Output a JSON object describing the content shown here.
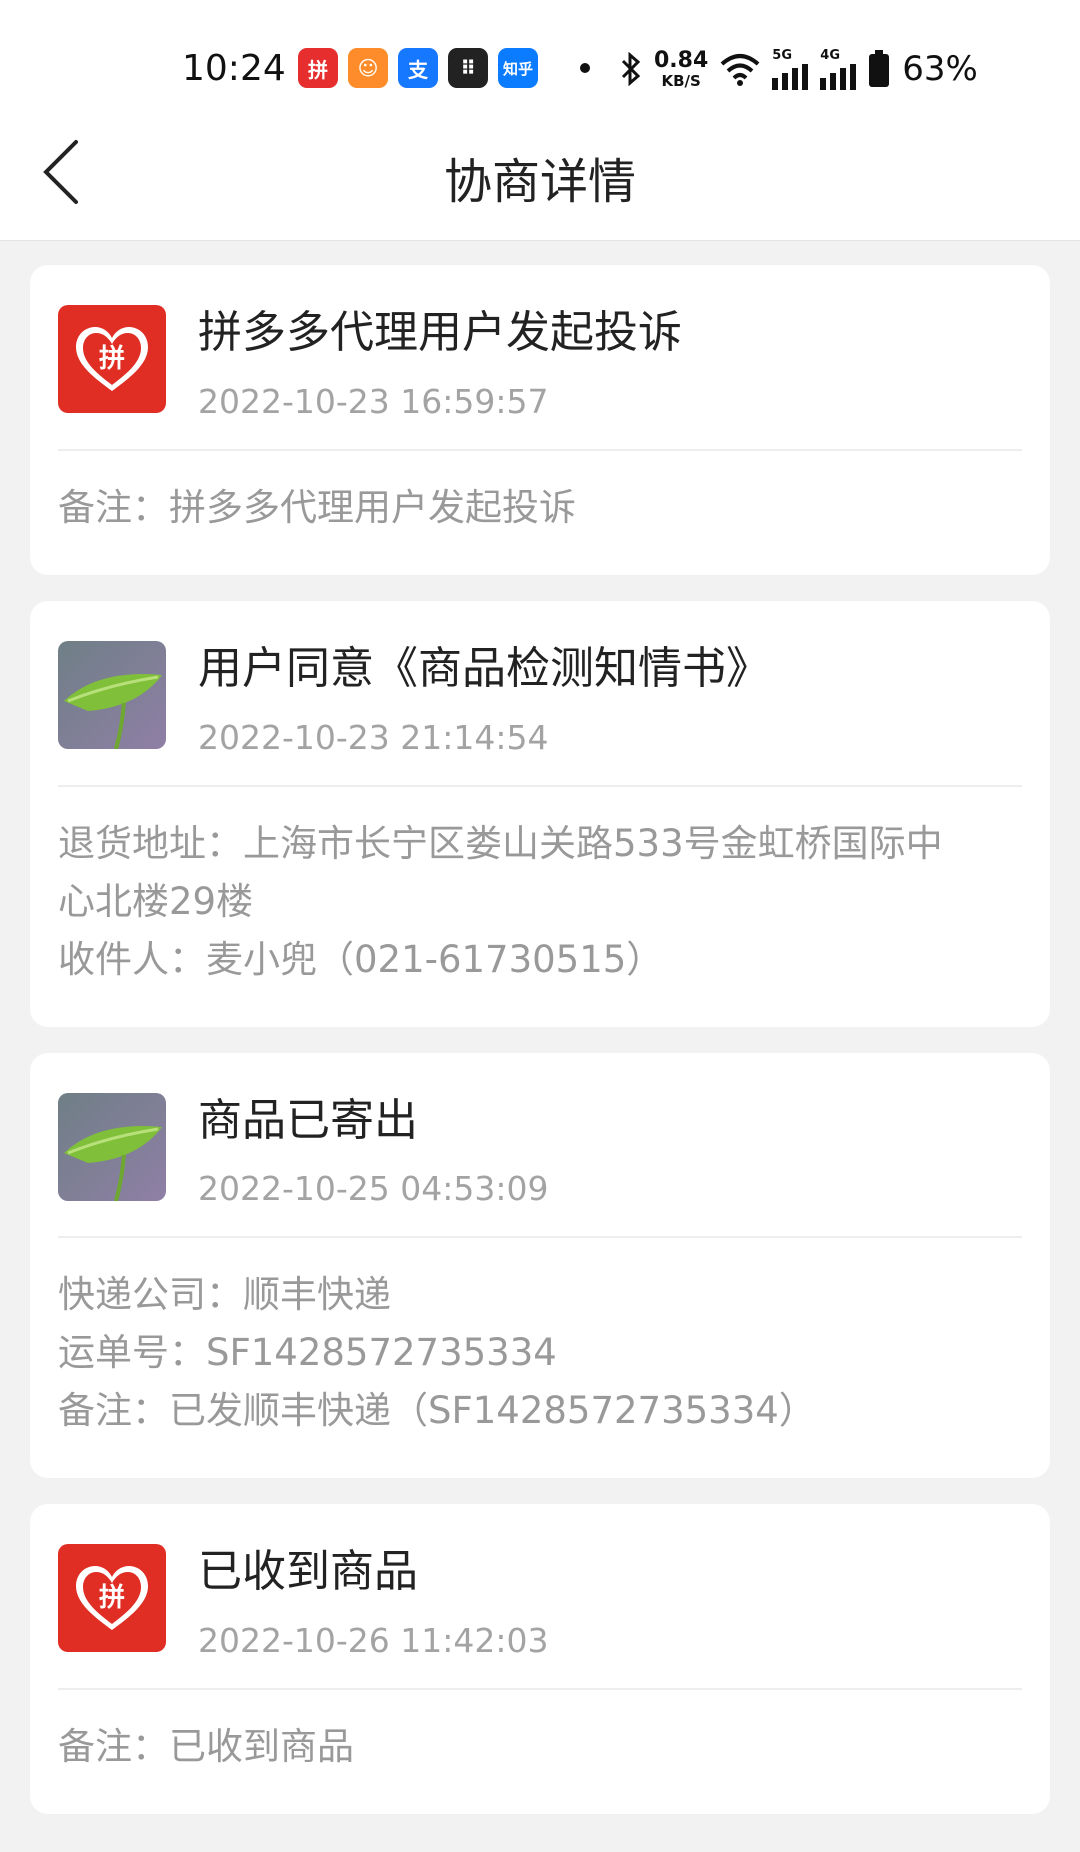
{
  "status_bar": {
    "time": "10:24",
    "apps": [
      {
        "icon": "pinduoduo-icon",
        "glyph": "拼"
      },
      {
        "icon": "person-app-icon",
        "glyph": "☺"
      },
      {
        "icon": "alipay-icon",
        "glyph": "支"
      },
      {
        "icon": "dots-app-icon",
        "glyph": "⠿"
      },
      {
        "icon": "zhihu-icon",
        "glyph": "知乎"
      }
    ],
    "net_speed_value": "0.84",
    "net_speed_unit": "KB/S",
    "signal_1": "5G",
    "signal_2": "4G",
    "battery": "63%"
  },
  "header": {
    "title": "协商详情"
  },
  "records": [
    {
      "avatar": "pinduoduo-logo",
      "title": "拼多多代理用户发起投诉",
      "time": "2022-10-23 16:59:57",
      "lines": [
        "备注：拼多多代理用户发起投诉"
      ]
    },
    {
      "avatar": "user-leaf-avatar",
      "title": "用户同意《商品检测知情书》",
      "time": "2022-10-23 21:14:54",
      "lines": [
        "退货地址：上海市长宁区娄山关路533号金虹桥国际中",
        "心北楼29楼",
        "收件人：麦小兜（021-61730515）"
      ]
    },
    {
      "avatar": "user-leaf-avatar",
      "title": "商品已寄出",
      "time": "2022-10-25 04:53:09",
      "lines": [
        "快递公司：顺丰快递",
        "运单号：SF1428572735334",
        "备注：已发顺丰快递（SF1428572735334）"
      ]
    },
    {
      "avatar": "pinduoduo-logo",
      "title": "已收到商品",
      "time": "2022-10-26 11:42:03",
      "lines": [
        "备注：已收到商品"
      ]
    }
  ],
  "colors": {
    "brand_red": "#e02e24",
    "title_text": "#222222",
    "secondary_text": "#999999",
    "background": "#f2f2f2"
  }
}
